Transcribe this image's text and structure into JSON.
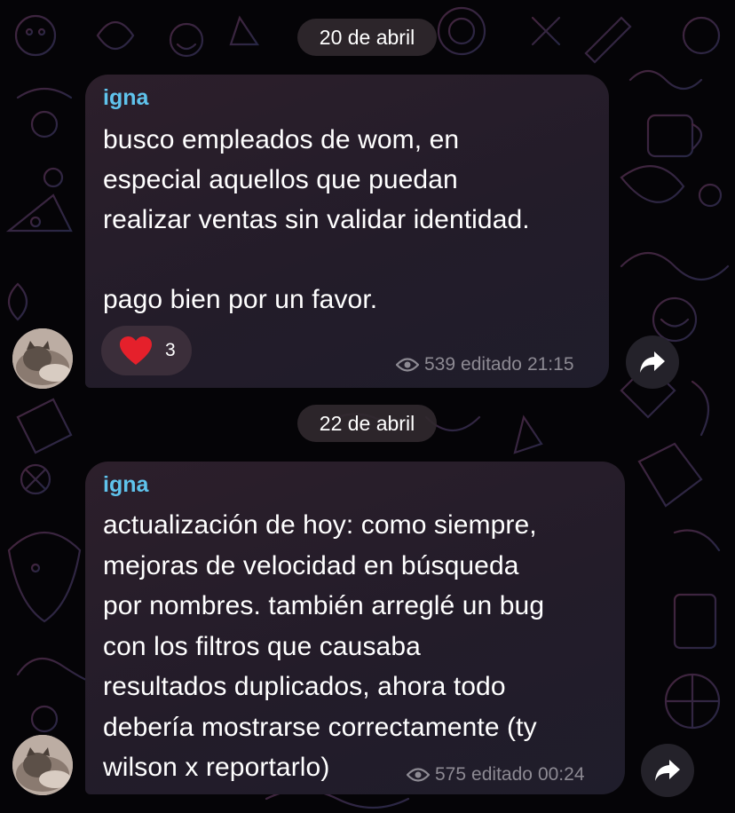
{
  "dates": [
    "20 de abril",
    "22 de abril"
  ],
  "messages": [
    {
      "sender": "igna",
      "text": "busco empleados de wom, en\nespecial aquellos que puedan\nrealizar ventas sin validar identidad.\n\npago bien por un favor.",
      "reaction": {
        "emoji": "heart-icon",
        "count": "3"
      },
      "views": "539",
      "edited_label": "editado",
      "time": "21:15"
    },
    {
      "sender": "igna",
      "text": "actualización de hoy: como siempre,\nmejoras de velocidad en búsqueda\npor nombres. también arreglé un bug\ncon los filtros que causaba\nresultados duplicados, ahora todo\ndebería mostrarse correctamente (ty\nwilson x reportarlo)",
      "views": "575",
      "edited_label": "editado",
      "time": "00:24"
    }
  ],
  "colors": {
    "sender_name": "#5fc3ec",
    "reaction_heart": "#e5202b",
    "background": "#050407"
  }
}
